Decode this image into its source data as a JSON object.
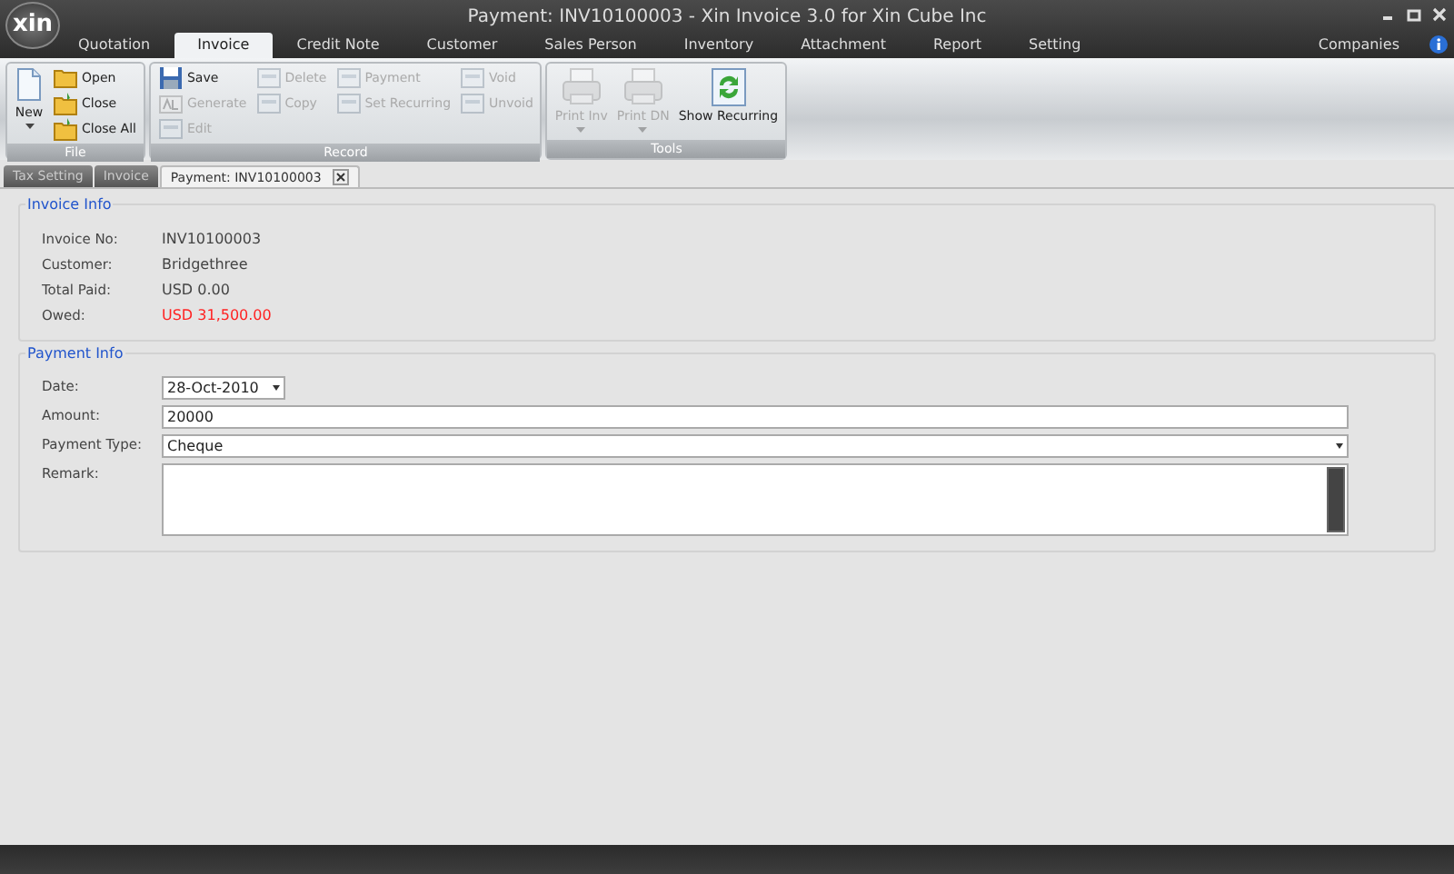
{
  "window": {
    "title": "Payment: INV10100003 - Xin Invoice 3.0 for Xin Cube Inc",
    "logo": "xin"
  },
  "menu_tabs": [
    {
      "label": "Quotation",
      "selected": false
    },
    {
      "label": "Invoice",
      "selected": true
    },
    {
      "label": "Credit Note",
      "selected": false
    },
    {
      "label": "Customer",
      "selected": false
    },
    {
      "label": "Sales Person",
      "selected": false
    },
    {
      "label": "Inventory",
      "selected": false
    },
    {
      "label": "Attachment",
      "selected": false
    },
    {
      "label": "Report",
      "selected": false
    },
    {
      "label": "Setting",
      "selected": false
    }
  ],
  "companies": "Companies",
  "ribbon": [
    {
      "label": "File",
      "columns": [
        [
          {
            "label": "New",
            "kind": "document",
            "disabled": false,
            "caret": true
          }
        ],
        [
          {
            "label": "Open",
            "kind": "folder",
            "disabled": false
          },
          {
            "label": "Close",
            "kind": "filing",
            "disabled": false
          },
          {
            "label": "Close All",
            "kind": "filing",
            "disabled": false
          }
        ]
      ]
    },
    {
      "label": "Record",
      "columns": [
        [
          {
            "label": "Save",
            "kind": "save",
            "disabled": false
          },
          {
            "label": "Generate",
            "kind": "ab",
            "disabled": true
          },
          {
            "label": "Edit",
            "kind": "page",
            "disabled": true
          }
        ],
        [
          {
            "label": "Delete",
            "kind": "page",
            "disabled": true
          },
          {
            "label": "Copy",
            "kind": "page",
            "disabled": true
          }
        ],
        [
          {
            "label": "Payment",
            "kind": "page",
            "disabled": true
          },
          {
            "label": "Set Recurring",
            "kind": "page",
            "disabled": true
          }
        ],
        [
          {
            "label": "Void",
            "kind": "page",
            "disabled": true
          },
          {
            "label": "Unvoid",
            "kind": "page",
            "disabled": true
          }
        ]
      ]
    },
    {
      "label": "Tools",
      "columns": [
        [
          {
            "label": "Print Inv",
            "kind": "printer",
            "disabled": true,
            "caret": true
          }
        ],
        [
          {
            "label": "Print DN",
            "kind": "printer",
            "disabled": true,
            "caret": true
          }
        ],
        [
          {
            "label": "Show Recurring",
            "kind": "recycle",
            "disabled": false,
            "caret": false
          }
        ]
      ]
    }
  ],
  "doc_tabs": [
    {
      "label": "Tax Setting",
      "selected": false,
      "closable": false
    },
    {
      "label": "Invoice",
      "selected": false,
      "closable": false
    },
    {
      "label": "Payment: INV10100003",
      "selected": true,
      "closable": true
    }
  ],
  "invoice_info": {
    "title": "Invoice Info",
    "rows": [
      {
        "label": "Invoice No:",
        "value": "INV10100003",
        "alert": false
      },
      {
        "label": "Customer:",
        "value": "Bridgethree",
        "alert": false
      },
      {
        "label": "Total Paid:",
        "value": "USD 0.00",
        "alert": false
      },
      {
        "label": "Owed:",
        "value": "USD 31,500.00",
        "alert": true
      }
    ]
  },
  "payment_info": {
    "title": "Payment Info",
    "fields": [
      {
        "label": "Date:",
        "kind": "date",
        "value": "28-Oct-2010"
      },
      {
        "label": "Amount:",
        "kind": "text",
        "value": "20000"
      },
      {
        "label": "Payment Type:",
        "kind": "select",
        "value": "Cheque"
      },
      {
        "label": "Remark:",
        "kind": "memo"
      }
    ]
  }
}
